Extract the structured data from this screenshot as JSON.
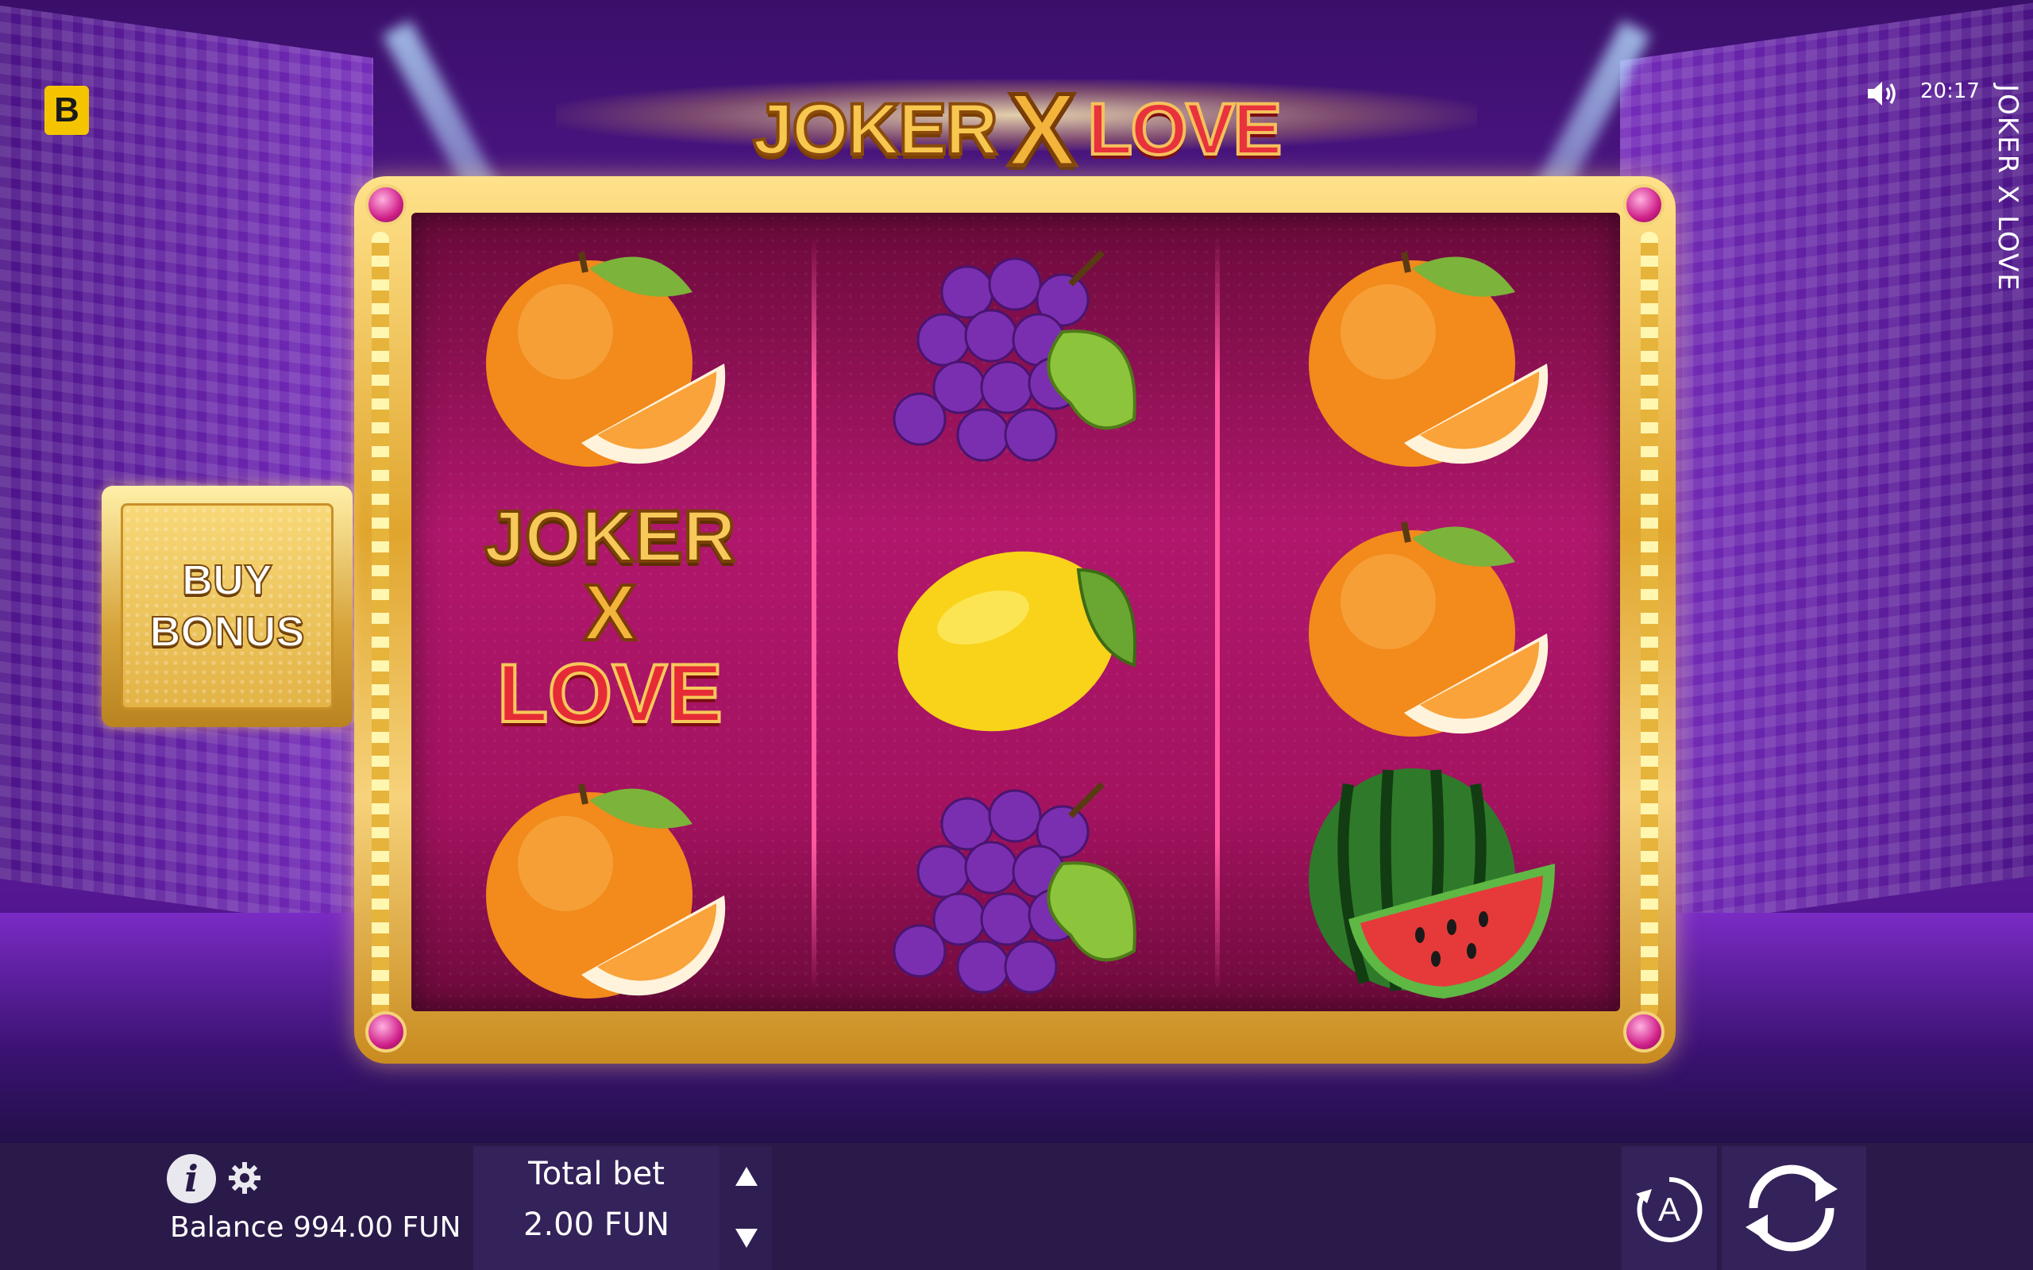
{
  "brand": {
    "badge": "B"
  },
  "topbar": {
    "time": "20:17",
    "vertical_title": "JOKER X LOVE",
    "sound_icon": "speaker-icon"
  },
  "game": {
    "title_word1": "JOKER",
    "title_x": "X",
    "title_word2": "LOVE",
    "reels": [
      [
        "orange",
        "joker-x-love",
        "orange"
      ],
      [
        "grapes",
        "lemon",
        "grapes"
      ],
      [
        "orange",
        "orange",
        "watermelon"
      ]
    ],
    "joker_symbol": {
      "line1": "JOKER",
      "line2": "X",
      "line3": "LOVE"
    }
  },
  "buy_bonus": {
    "line1": "BUY",
    "line2": "BONUS"
  },
  "bottom": {
    "balance_label": "Balance 994.00 FUN",
    "bet_label": "Total bet",
    "bet_value": "2.00 FUN",
    "info_icon": "info-icon",
    "settings_icon": "gear-icon",
    "autoplay_label": "A",
    "spin_icon": "spin-icon"
  },
  "colors": {
    "accent_gold": "#f2b43a",
    "reel_bg": "#a3125f",
    "bar_bg": "#2a1a4a",
    "brand_yellow": "#f5c400"
  }
}
